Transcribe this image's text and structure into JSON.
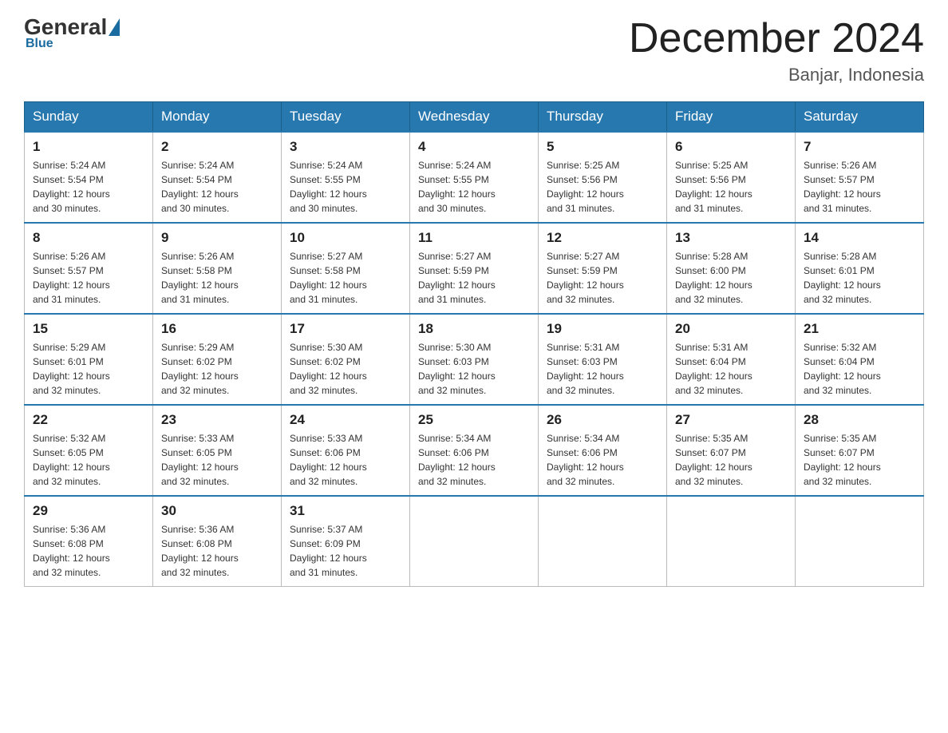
{
  "logo": {
    "general": "General",
    "blue": "Blue"
  },
  "header": {
    "title": "December 2024",
    "subtitle": "Banjar, Indonesia"
  },
  "weekdays": [
    "Sunday",
    "Monday",
    "Tuesday",
    "Wednesday",
    "Thursday",
    "Friday",
    "Saturday"
  ],
  "weeks": [
    [
      {
        "day": 1,
        "sunrise": "5:24 AM",
        "sunset": "5:54 PM",
        "daylight": "12 hours and 30 minutes."
      },
      {
        "day": 2,
        "sunrise": "5:24 AM",
        "sunset": "5:54 PM",
        "daylight": "12 hours and 30 minutes."
      },
      {
        "day": 3,
        "sunrise": "5:24 AM",
        "sunset": "5:55 PM",
        "daylight": "12 hours and 30 minutes."
      },
      {
        "day": 4,
        "sunrise": "5:24 AM",
        "sunset": "5:55 PM",
        "daylight": "12 hours and 30 minutes."
      },
      {
        "day": 5,
        "sunrise": "5:25 AM",
        "sunset": "5:56 PM",
        "daylight": "12 hours and 31 minutes."
      },
      {
        "day": 6,
        "sunrise": "5:25 AM",
        "sunset": "5:56 PM",
        "daylight": "12 hours and 31 minutes."
      },
      {
        "day": 7,
        "sunrise": "5:26 AM",
        "sunset": "5:57 PM",
        "daylight": "12 hours and 31 minutes."
      }
    ],
    [
      {
        "day": 8,
        "sunrise": "5:26 AM",
        "sunset": "5:57 PM",
        "daylight": "12 hours and 31 minutes."
      },
      {
        "day": 9,
        "sunrise": "5:26 AM",
        "sunset": "5:58 PM",
        "daylight": "12 hours and 31 minutes."
      },
      {
        "day": 10,
        "sunrise": "5:27 AM",
        "sunset": "5:58 PM",
        "daylight": "12 hours and 31 minutes."
      },
      {
        "day": 11,
        "sunrise": "5:27 AM",
        "sunset": "5:59 PM",
        "daylight": "12 hours and 31 minutes."
      },
      {
        "day": 12,
        "sunrise": "5:27 AM",
        "sunset": "5:59 PM",
        "daylight": "12 hours and 32 minutes."
      },
      {
        "day": 13,
        "sunrise": "5:28 AM",
        "sunset": "6:00 PM",
        "daylight": "12 hours and 32 minutes."
      },
      {
        "day": 14,
        "sunrise": "5:28 AM",
        "sunset": "6:01 PM",
        "daylight": "12 hours and 32 minutes."
      }
    ],
    [
      {
        "day": 15,
        "sunrise": "5:29 AM",
        "sunset": "6:01 PM",
        "daylight": "12 hours and 32 minutes."
      },
      {
        "day": 16,
        "sunrise": "5:29 AM",
        "sunset": "6:02 PM",
        "daylight": "12 hours and 32 minutes."
      },
      {
        "day": 17,
        "sunrise": "5:30 AM",
        "sunset": "6:02 PM",
        "daylight": "12 hours and 32 minutes."
      },
      {
        "day": 18,
        "sunrise": "5:30 AM",
        "sunset": "6:03 PM",
        "daylight": "12 hours and 32 minutes."
      },
      {
        "day": 19,
        "sunrise": "5:31 AM",
        "sunset": "6:03 PM",
        "daylight": "12 hours and 32 minutes."
      },
      {
        "day": 20,
        "sunrise": "5:31 AM",
        "sunset": "6:04 PM",
        "daylight": "12 hours and 32 minutes."
      },
      {
        "day": 21,
        "sunrise": "5:32 AM",
        "sunset": "6:04 PM",
        "daylight": "12 hours and 32 minutes."
      }
    ],
    [
      {
        "day": 22,
        "sunrise": "5:32 AM",
        "sunset": "6:05 PM",
        "daylight": "12 hours and 32 minutes."
      },
      {
        "day": 23,
        "sunrise": "5:33 AM",
        "sunset": "6:05 PM",
        "daylight": "12 hours and 32 minutes."
      },
      {
        "day": 24,
        "sunrise": "5:33 AM",
        "sunset": "6:06 PM",
        "daylight": "12 hours and 32 minutes."
      },
      {
        "day": 25,
        "sunrise": "5:34 AM",
        "sunset": "6:06 PM",
        "daylight": "12 hours and 32 minutes."
      },
      {
        "day": 26,
        "sunrise": "5:34 AM",
        "sunset": "6:06 PM",
        "daylight": "12 hours and 32 minutes."
      },
      {
        "day": 27,
        "sunrise": "5:35 AM",
        "sunset": "6:07 PM",
        "daylight": "12 hours and 32 minutes."
      },
      {
        "day": 28,
        "sunrise": "5:35 AM",
        "sunset": "6:07 PM",
        "daylight": "12 hours and 32 minutes."
      }
    ],
    [
      {
        "day": 29,
        "sunrise": "5:36 AM",
        "sunset": "6:08 PM",
        "daylight": "12 hours and 32 minutes."
      },
      {
        "day": 30,
        "sunrise": "5:36 AM",
        "sunset": "6:08 PM",
        "daylight": "12 hours and 32 minutes."
      },
      {
        "day": 31,
        "sunrise": "5:37 AM",
        "sunset": "6:09 PM",
        "daylight": "12 hours and 31 minutes."
      },
      null,
      null,
      null,
      null
    ]
  ],
  "labels": {
    "sunrise": "Sunrise:",
    "sunset": "Sunset:",
    "daylight": "Daylight:"
  }
}
